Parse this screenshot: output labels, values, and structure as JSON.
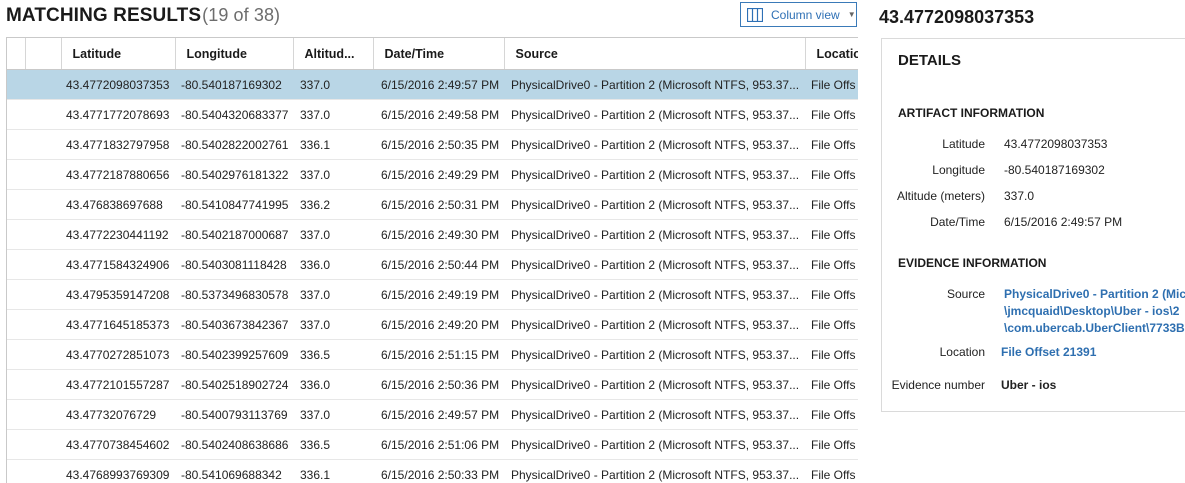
{
  "header": {
    "title": "MATCHING RESULTS",
    "count": "(19 of 38)"
  },
  "column_view": {
    "label": "Column view",
    "icon": "columns-icon"
  },
  "table": {
    "columns": [
      "Latitude",
      "Longitude",
      "Altitud...",
      "Date/Time",
      "Source",
      "Locatio"
    ],
    "rows": [
      [
        "43.4772098037353",
        "-80.540187169302",
        "337.0",
        "6/15/2016 2:49:57 PM",
        "PhysicalDrive0 - Partition 2 (Microsoft NTFS, 953.37...",
        "File Offs"
      ],
      [
        "43.4771772078693",
        "-80.5404320683377",
        "337.0",
        "6/15/2016 2:49:58 PM",
        "PhysicalDrive0 - Partition 2 (Microsoft NTFS, 953.37...",
        "File Offs"
      ],
      [
        "43.4771832797958",
        "-80.5402822002761",
        "336.1",
        "6/15/2016 2:50:35 PM",
        "PhysicalDrive0 - Partition 2 (Microsoft NTFS, 953.37...",
        "File Offs"
      ],
      [
        "43.4772187880656",
        "-80.5402976181322",
        "337.0",
        "6/15/2016 2:49:29 PM",
        "PhysicalDrive0 - Partition 2 (Microsoft NTFS, 953.37...",
        "File Offs"
      ],
      [
        "43.476838697688",
        "-80.5410847741995",
        "336.2",
        "6/15/2016 2:50:31 PM",
        "PhysicalDrive0 - Partition 2 (Microsoft NTFS, 953.37...",
        "File Offs"
      ],
      [
        "43.4772230441192",
        "-80.5402187000687",
        "337.0",
        "6/15/2016 2:49:30 PM",
        "PhysicalDrive0 - Partition 2 (Microsoft NTFS, 953.37...",
        "File Offs"
      ],
      [
        "43.4771584324906",
        "-80.5403081118428",
        "336.0",
        "6/15/2016 2:50:44 PM",
        "PhysicalDrive0 - Partition 2 (Microsoft NTFS, 953.37...",
        "File Offs"
      ],
      [
        "43.4795359147208",
        "-80.5373496830578",
        "337.0",
        "6/15/2016 2:49:19 PM",
        "PhysicalDrive0 - Partition 2 (Microsoft NTFS, 953.37...",
        "File Offs"
      ],
      [
        "43.4771645185373",
        "-80.5403673842367",
        "337.0",
        "6/15/2016 2:49:20 PM",
        "PhysicalDrive0 - Partition 2 (Microsoft NTFS, 953.37...",
        "File Offs"
      ],
      [
        "43.4770272851073",
        "-80.5402399257609",
        "336.5",
        "6/15/2016 2:51:15 PM",
        "PhysicalDrive0 - Partition 2 (Microsoft NTFS, 953.37...",
        "File Offs"
      ],
      [
        "43.4772101557287",
        "-80.5402518902724",
        "336.0",
        "6/15/2016 2:50:36 PM",
        "PhysicalDrive0 - Partition 2 (Microsoft NTFS, 953.37...",
        "File Offs"
      ],
      [
        "43.47732076729",
        "-80.5400793113769",
        "337.0",
        "6/15/2016 2:49:57 PM",
        "PhysicalDrive0 - Partition 2 (Microsoft NTFS, 953.37...",
        "File Offs"
      ],
      [
        "43.4770738454602",
        "-80.5402408638686",
        "336.5",
        "6/15/2016 2:51:06 PM",
        "PhysicalDrive0 - Partition 2 (Microsoft NTFS, 953.37...",
        "File Offs"
      ],
      [
        "43.4768993769309",
        "-80.541069688342",
        "336.1",
        "6/15/2016 2:50:33 PM",
        "PhysicalDrive0 - Partition 2 (Microsoft NTFS, 953.37...",
        "File Offs"
      ]
    ],
    "selected_row": 0
  },
  "selected_value": "43.4772098037353",
  "details": {
    "title": "DETAILS",
    "artifact_section": "ARTIFACT INFORMATION",
    "artifact": [
      {
        "label": "Latitude",
        "value": "43.4772098037353"
      },
      {
        "label": "Longitude",
        "value": "-80.540187169302"
      },
      {
        "label": "Altitude (meters)",
        "value": "337.0"
      },
      {
        "label": "Date/Time",
        "value": "6/15/2016 2:49:57 PM"
      }
    ],
    "evidence_section": "EVIDENCE INFORMATION",
    "source_label": "Source",
    "source_lines": [
      "PhysicalDrive0 - Partition 2 (Mic",
      "\\jmcquaid\\Desktop\\Uber - ios\\2",
      "\\com.ubercab.UberClient\\7733B"
    ],
    "location_label": "Location",
    "location_value": "File Offset 21391",
    "evidence_number_label": "Evidence number",
    "evidence_number_value": "Uber - ios"
  }
}
